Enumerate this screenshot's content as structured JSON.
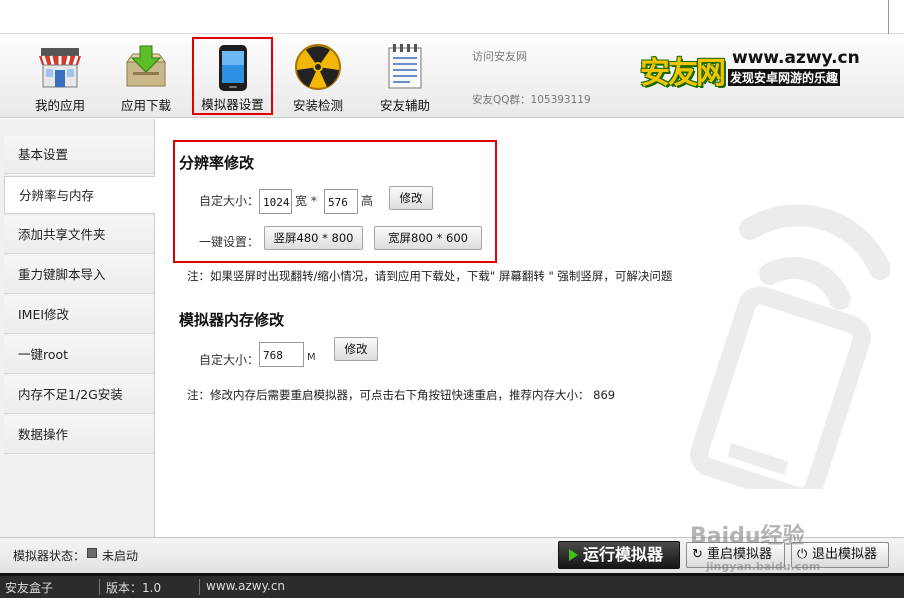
{
  "toolbar": {
    "buttons": [
      {
        "label": "我的应用",
        "icon": "store-icon"
      },
      {
        "label": "应用下载",
        "icon": "download-box-icon"
      },
      {
        "label": "模拟器设置",
        "icon": "phone-icon"
      },
      {
        "label": "安装检测",
        "icon": "radiation-icon"
      },
      {
        "label": "安友辅助",
        "icon": "notepad-icon"
      }
    ],
    "visit_link": "访问安友网",
    "qq_group": "安友QQ群：105393119",
    "logo_big": "安友网",
    "logo_url": "www.azwy.cn",
    "logo_slogan": "发现安卓网游的乐趣"
  },
  "sidebar": {
    "items": [
      "基本设置",
      "分辨率与内存",
      "添加共享文件夹",
      "重力键脚本导入",
      "IMEI修改",
      "一键root",
      "内存不足1/2G安装",
      "数据操作"
    ],
    "active_index": 1
  },
  "resolution": {
    "title": "分辨率修改",
    "custom_label": "自定大小：",
    "width_value": "1024",
    "width_unit": "宽 *",
    "height_value": "576",
    "height_unit": "高",
    "modify_button": "修改",
    "onekey_label": "一键设置：",
    "portrait_button": "竖屏480 * 800",
    "landscape_button": "宽屏800 * 600",
    "note": "注：如果竖屏时出现翻转/缩小情况，请到应用下载处，下载\" 屏幕翻转 \" 强制竖屏，可解决问题"
  },
  "memory": {
    "title": "模拟器内存修改",
    "custom_label": "自定大小：",
    "value": "768",
    "unit": "M",
    "modify_button": "修改",
    "note": "注：修改内存后需要重启模拟器，可点击右下角按钮快速重启，推荐内存大小：  869"
  },
  "bottom": {
    "status_label": "模拟器状态：",
    "status_value": "未启动",
    "run_button": "运行模拟器",
    "restart_button": "重启模拟器",
    "exit_button": "退出模拟器"
  },
  "statusbar": {
    "app_name": "安友盒子",
    "version": "版本：1.0",
    "site": "www.azwy.cn"
  },
  "watermark": {
    "brand": "Baidu经验",
    "sub": "jingyan.baidu.com"
  },
  "colors": {
    "highlight_red": "#e00000",
    "run_green": "#3fc21a",
    "logo_yellow": "#f4c400"
  }
}
